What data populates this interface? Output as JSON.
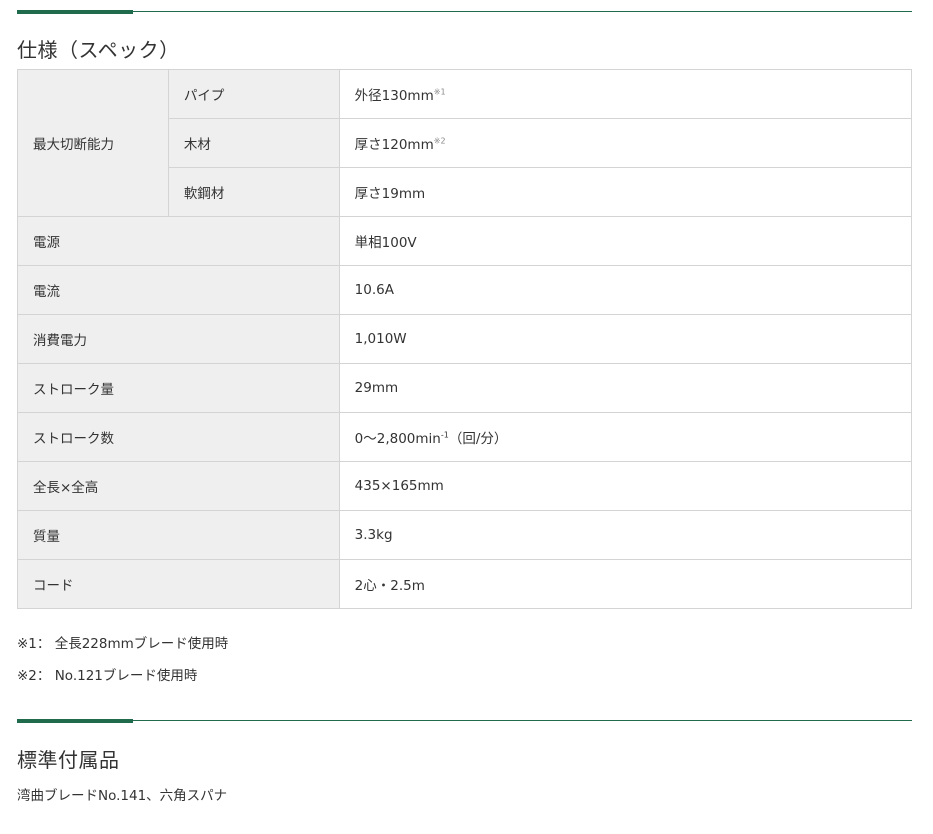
{
  "spec_section": {
    "title": "仕様（スペック）",
    "cutting_capacity": {
      "label": "最大切断能力",
      "rows": [
        {
          "name": "パイプ",
          "value": "外径130mm",
          "mark": "※1"
        },
        {
          "name": "木材",
          "value": "厚さ120mm",
          "mark": "※2"
        },
        {
          "name": "軟鋼材",
          "value": "厚さ19mm"
        }
      ]
    },
    "rows": [
      {
        "label": "電源",
        "value": "単相100V"
      },
      {
        "label": "電流",
        "value": "10.6A"
      },
      {
        "label": "消費電力",
        "value": "1,010W"
      },
      {
        "label": "ストローク量",
        "value": "29mm"
      },
      {
        "label": "ストローク数",
        "value_main": "0〜2,800min",
        "value_sup": "-1",
        "value_tail": "（回/分）"
      },
      {
        "label": "全長×全高",
        "value": "435×165mm"
      },
      {
        "label": "質量",
        "value": "3.3kg"
      },
      {
        "label": "コード",
        "value": "2心・2.5m"
      }
    ],
    "notes": [
      "※1： 全長228mmブレード使用時",
      "※2： No.121ブレード使用時"
    ]
  },
  "accessories_section": {
    "title": "標準付属品",
    "text": "湾曲ブレードNo.141、六角スパナ"
  },
  "colors": {
    "accent": "#1f6b4b",
    "label_bg": "#efefef",
    "border": "#d4d4d4"
  }
}
